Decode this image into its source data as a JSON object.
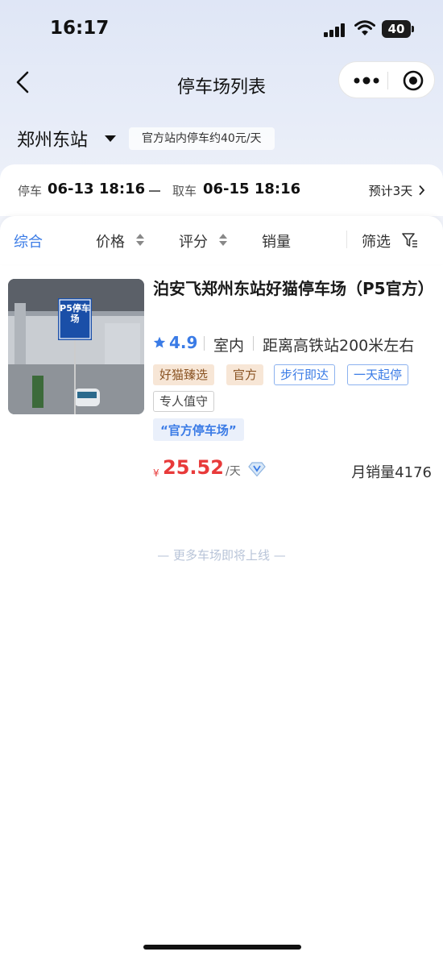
{
  "status_bar": {
    "time": "16:17",
    "battery": "40"
  },
  "nav": {
    "title": "停车场列表"
  },
  "station": {
    "name": "郑州东站",
    "note": "官方站内停车约40元/天"
  },
  "dates": {
    "park_label": "停车",
    "park_value": "06-13 18:16",
    "pickup_label": "取车",
    "pickup_value": "06-15 18:16",
    "estimate": "预计3天"
  },
  "filters": {
    "comprehensive": "综合",
    "price": "价格",
    "rating": "评分",
    "sales": "销量",
    "filter": "筛选"
  },
  "lots": [
    {
      "photo_sign": "P5停车场",
      "name": "泊安飞郑州东站好猫停车场（P5官方）",
      "rating": "4.9",
      "type": "室内",
      "distance": "距离高铁站200米左右",
      "tags_orange": [
        "好猫臻选",
        "官方"
      ],
      "tags_blue": [
        "步行即达",
        "一天起停"
      ],
      "tag_grey": "专人值守",
      "quote": "“官方停车场”",
      "price_symbol": "¥",
      "price": "25.52",
      "price_unit": "/天",
      "monthly_sales": "月销量4176"
    }
  ],
  "footer_note": "— 更多车场即将上线 —",
  "colors": {
    "accent": "#3a7be6",
    "price": "#e83a3a",
    "tag_orange_bg": "#f7e6d6"
  }
}
